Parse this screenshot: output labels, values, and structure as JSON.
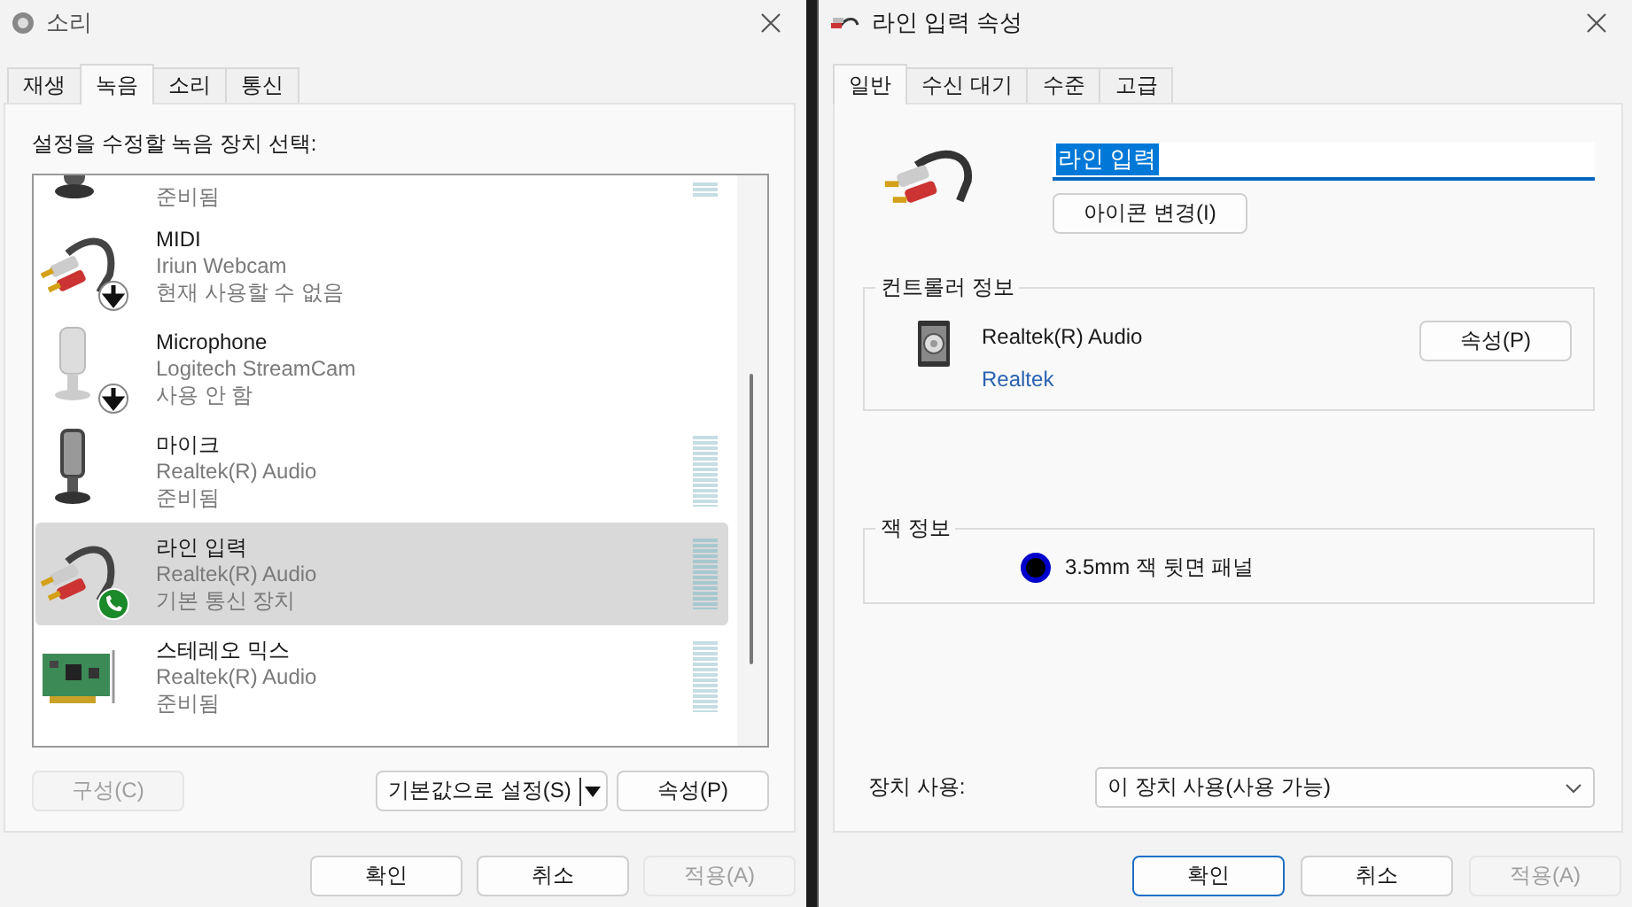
{
  "left_window": {
    "title": "소리",
    "tabs": [
      {
        "label": "재생",
        "selected": false
      },
      {
        "label": "녹음",
        "selected": true
      },
      {
        "label": "소리",
        "selected": false
      },
      {
        "label": "통신",
        "selected": false
      }
    ],
    "prompt": "설정을 수정할 녹음 장치 선택:",
    "devices": [
      {
        "kind": "desk-mic",
        "down_badge": false,
        "phone_badge": false,
        "cut_off": true,
        "status": "준비됨",
        "selected": false,
        "meter": true,
        "level": 0
      },
      {
        "kind": "cable",
        "down_badge": true,
        "phone_badge": false,
        "cut_off": false,
        "name": "MIDI",
        "driver": "Iriun Webcam",
        "status": "현재 사용할 수 없음",
        "selected": false,
        "meter": false
      },
      {
        "kind": "webcam-mic",
        "down_badge": true,
        "phone_badge": false,
        "cut_off": false,
        "name": "Microphone",
        "driver": "Logitech StreamCam",
        "status": "사용 안 함",
        "selected": false,
        "meter": false
      },
      {
        "kind": "mic",
        "down_badge": false,
        "phone_badge": false,
        "cut_off": false,
        "name": "마이크",
        "driver": "Realtek(R) Audio",
        "status": "준비됨",
        "selected": false,
        "meter": true,
        "level": 0
      },
      {
        "kind": "cable",
        "down_badge": false,
        "phone_badge": true,
        "cut_off": false,
        "name": "라인 입력",
        "driver": "Realtek(R) Audio",
        "status": "기본 통신 장치",
        "selected": true,
        "meter": true,
        "level": 0
      },
      {
        "kind": "sound-card",
        "down_badge": false,
        "phone_badge": false,
        "cut_off": false,
        "name": "스테레오 믹스",
        "driver": "Realtek(R) Audio",
        "status": "준비됨",
        "selected": false,
        "meter": true,
        "level": 0
      }
    ],
    "configure_button": {
      "label": "구성(C)",
      "disabled": true
    },
    "set_default_button": {
      "label": "기본값으로 설정(S)",
      "disabled": false
    },
    "properties_button": {
      "label": "속성(P)",
      "disabled": false
    },
    "buttons": [
      {
        "label": "확인",
        "disabled": false,
        "default": false
      },
      {
        "label": "취소",
        "disabled": false,
        "default": false
      },
      {
        "label": "적용(A)",
        "disabled": true,
        "default": false
      }
    ]
  },
  "right_window": {
    "title": "라인 입력 속성",
    "tabs": [
      {
        "label": "일반",
        "selected": true
      },
      {
        "label": "수신 대기",
        "selected": false
      },
      {
        "label": "수준",
        "selected": false
      },
      {
        "label": "고급",
        "selected": false
      }
    ],
    "name_field": {
      "value": "라인 입력",
      "text_selected": true
    },
    "change_icon_button": "아이콘 변경(I)",
    "controller": {
      "heading": "컨트롤러 정보",
      "name": "Realtek(R) Audio",
      "vendor": "Realtek",
      "button": "속성(P)"
    },
    "jack": {
      "heading": "잭 정보",
      "items": [
        {
          "label": "3.5mm 잭 뒷면 패널",
          "color": "#0000cc"
        }
      ]
    },
    "device_usage": {
      "label": "장치 사용:",
      "value": "이 장치 사용(사용 가능)"
    },
    "buttons": [
      {
        "label": "확인",
        "disabled": false,
        "default": true
      },
      {
        "label": "취소",
        "disabled": false,
        "default": false
      },
      {
        "label": "적용(A)",
        "disabled": true,
        "default": false
      }
    ]
  }
}
